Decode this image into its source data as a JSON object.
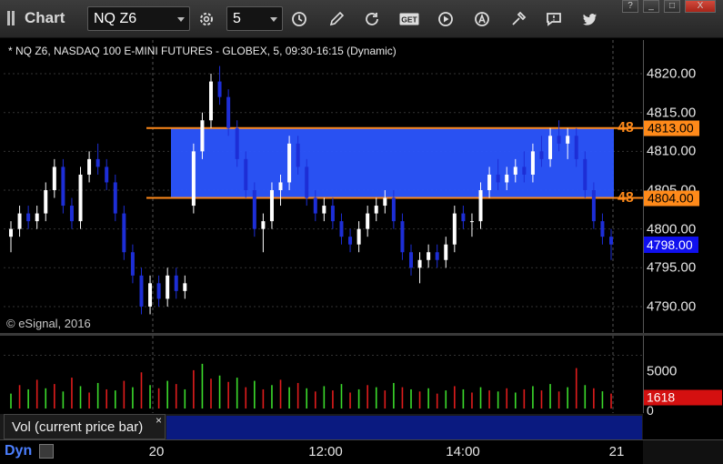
{
  "app": {
    "title": "Chart"
  },
  "toolbar": {
    "symbol": "NQ Z6",
    "interval": "5",
    "icons": [
      "settings-cog-icon",
      "clock-icon",
      "pencil-icon",
      "refresh-icon",
      "get-icon",
      "play-icon",
      "alert-icon",
      "tools-icon",
      "chat-icon",
      "twitter-icon"
    ],
    "get_label": "GET"
  },
  "window": {
    "help": "?",
    "minimize": "_",
    "maximize": "□",
    "close": "X"
  },
  "chart": {
    "header": "* NQ Z6, NASDAQ 100 E-MINI FUTURES - GLOBEX, 5, 09:30-16:15 (Dynamic)",
    "copyright": "© eSignal, 2016",
    "price_ticks": [
      "4820.00",
      "4815.00",
      "4810.00",
      "4805.00",
      "4800.00",
      "4795.00",
      "4790.00"
    ],
    "levels": [
      {
        "num": "48",
        "label": "4813.00",
        "value": 4813
      },
      {
        "num": "48",
        "label": "4804.00",
        "value": 4804
      }
    ],
    "last_price": "4798.00",
    "colors": {
      "zone": "#2b55ff",
      "level": "#ff8a1a",
      "up": "#ffffff",
      "down": "#1d2ed6",
      "vol_up": "#3cdc2c",
      "vol_down": "#e01c1c"
    }
  },
  "volume": {
    "label": "Vol (current price bar)",
    "close": "×",
    "ticks": [
      "5000",
      "0"
    ],
    "last": "1618"
  },
  "time_axis": {
    "mode": "Dyn",
    "labels": [
      "20",
      "12:00",
      "14:00",
      "21"
    ]
  },
  "chart_data": {
    "type": "candlestick",
    "y_range": [
      4788,
      4822
    ],
    "zone": [
      4804,
      4813
    ],
    "candles": [
      [
        4799,
        4801,
        4797,
        4800
      ],
      [
        4800,
        4803,
        4799,
        4802
      ],
      [
        4802,
        4803,
        4800,
        4801
      ],
      [
        4801,
        4803,
        4800,
        4802
      ],
      [
        4802,
        4806,
        4801,
        4805
      ],
      [
        4805,
        4809,
        4804,
        4808
      ],
      [
        4808,
        4809,
        4802,
        4803
      ],
      [
        4803,
        4804,
        4800,
        4801
      ],
      [
        4801,
        4808,
        4800,
        4807
      ],
      [
        4807,
        4810,
        4806,
        4809
      ],
      [
        4809,
        4811,
        4807,
        4808
      ],
      [
        4808,
        4809,
        4805,
        4806
      ],
      [
        4806,
        4807,
        4801,
        4802
      ],
      [
        4802,
        4803,
        4796,
        4797
      ],
      [
        4797,
        4798,
        4793,
        4794
      ],
      [
        4794,
        4795,
        4789,
        4790
      ],
      [
        4790,
        4794,
        4789,
        4793
      ],
      [
        4793,
        4794,
        4790,
        4791
      ],
      [
        4791,
        4795,
        4790,
        4794
      ],
      [
        4794,
        4795,
        4791,
        4792
      ],
      [
        4792,
        4794,
        4791,
        4793
      ],
      [
        4803,
        4811,
        4802,
        4810
      ],
      [
        4810,
        4815,
        4809,
        4814
      ],
      [
        4814,
        4820,
        4813,
        4819
      ],
      [
        4819,
        4821,
        4816,
        4817
      ],
      [
        4817,
        4818,
        4812,
        4813
      ],
      [
        4813,
        4814,
        4808,
        4809
      ],
      [
        4809,
        4810,
        4804,
        4805
      ],
      [
        4805,
        4806,
        4799,
        4800
      ],
      [
        4800,
        4802,
        4797,
        4801
      ],
      [
        4801,
        4806,
        4800,
        4805
      ],
      [
        4805,
        4807,
        4803,
        4806
      ],
      [
        4806,
        4812,
        4805,
        4811
      ],
      [
        4811,
        4812,
        4807,
        4808
      ],
      [
        4808,
        4809,
        4803,
        4804
      ],
      [
        4804,
        4805,
        4801,
        4802
      ],
      [
        4802,
        4804,
        4801,
        4803
      ],
      [
        4803,
        4804,
        4800,
        4801
      ],
      [
        4801,
        4802,
        4798,
        4799
      ],
      [
        4799,
        4800,
        4797,
        4798
      ],
      [
        4798,
        4801,
        4797,
        4800
      ],
      [
        4800,
        4803,
        4799,
        4802
      ],
      [
        4802,
        4804,
        4801,
        4803
      ],
      [
        4803,
        4805,
        4802,
        4804
      ],
      [
        4804,
        4805,
        4800,
        4801
      ],
      [
        4801,
        4802,
        4796,
        4797
      ],
      [
        4797,
        4798,
        4794,
        4795
      ],
      [
        4795,
        4797,
        4793,
        4796
      ],
      [
        4796,
        4798,
        4795,
        4797
      ],
      [
        4797,
        4798,
        4795,
        4796
      ],
      [
        4796,
        4799,
        4795,
        4798
      ],
      [
        4798,
        4803,
        4797,
        4802
      ],
      [
        4802,
        4803,
        4800,
        4801
      ],
      [
        4801,
        4802,
        4799,
        4801
      ],
      [
        4801,
        4806,
        4800,
        4805
      ],
      [
        4805,
        4808,
        4804,
        4807
      ],
      [
        4807,
        4809,
        4805,
        4806
      ],
      [
        4806,
        4808,
        4805,
        4807
      ],
      [
        4807,
        4809,
        4806,
        4808
      ],
      [
        4808,
        4810,
        4806,
        4807
      ],
      [
        4807,
        4811,
        4806,
        4810
      ],
      [
        4810,
        4812,
        4808,
        4809
      ],
      [
        4809,
        4813,
        4808,
        4812
      ],
      [
        4812,
        4814,
        4810,
        4811
      ],
      [
        4811,
        4813,
        4809,
        4812
      ],
      [
        4812,
        4813,
        4808,
        4809
      ],
      [
        4809,
        4810,
        4804,
        4805
      ],
      [
        4805,
        4806,
        4800,
        4801
      ],
      [
        4801,
        4802,
        4798,
        4799
      ],
      [
        4799,
        4800,
        4796,
        4798
      ]
    ],
    "volumes": [
      [
        1400,
        1
      ],
      [
        2200,
        0
      ],
      [
        1800,
        1
      ],
      [
        2700,
        0
      ],
      [
        1900,
        1
      ],
      [
        2300,
        0
      ],
      [
        1600,
        1
      ],
      [
        2900,
        0
      ],
      [
        2100,
        1
      ],
      [
        1500,
        0
      ],
      [
        2400,
        1
      ],
      [
        1800,
        0
      ],
      [
        1700,
        1
      ],
      [
        2600,
        0
      ],
      [
        2000,
        1
      ],
      [
        3400,
        0
      ],
      [
        2200,
        1
      ],
      [
        1900,
        0
      ],
      [
        2600,
        1
      ],
      [
        2300,
        0
      ],
      [
        1800,
        1
      ],
      [
        3600,
        0
      ],
      [
        4200,
        1
      ],
      [
        2800,
        0
      ],
      [
        3100,
        1
      ],
      [
        2500,
        0
      ],
      [
        2900,
        1
      ],
      [
        2000,
        0
      ],
      [
        2600,
        1
      ],
      [
        1800,
        0
      ],
      [
        2200,
        1
      ],
      [
        2700,
        0
      ],
      [
        2000,
        1
      ],
      [
        2400,
        0
      ],
      [
        1900,
        1
      ],
      [
        1600,
        0
      ],
      [
        2100,
        1
      ],
      [
        1700,
        0
      ],
      [
        2300,
        1
      ],
      [
        1500,
        0
      ],
      [
        1800,
        1
      ],
      [
        2200,
        0
      ],
      [
        2000,
        1
      ],
      [
        1700,
        0
      ],
      [
        2400,
        1
      ],
      [
        2000,
        0
      ],
      [
        1800,
        1
      ],
      [
        1600,
        0
      ],
      [
        1900,
        1
      ],
      [
        1400,
        0
      ],
      [
        1700,
        1
      ],
      [
        2100,
        0
      ],
      [
        1800,
        1
      ],
      [
        1500,
        0
      ],
      [
        2000,
        1
      ],
      [
        1700,
        0
      ],
      [
        1600,
        1
      ],
      [
        1900,
        0
      ],
      [
        1500,
        1
      ],
      [
        1800,
        0
      ],
      [
        2100,
        1
      ],
      [
        1700,
        0
      ],
      [
        2300,
        1
      ],
      [
        1600,
        0
      ],
      [
        2000,
        1
      ],
      [
        3800,
        0
      ],
      [
        2200,
        1
      ],
      [
        1900,
        0
      ],
      [
        1618,
        1
      ],
      [
        1400,
        0
      ]
    ],
    "vol_range": [
      0,
      6500
    ]
  }
}
